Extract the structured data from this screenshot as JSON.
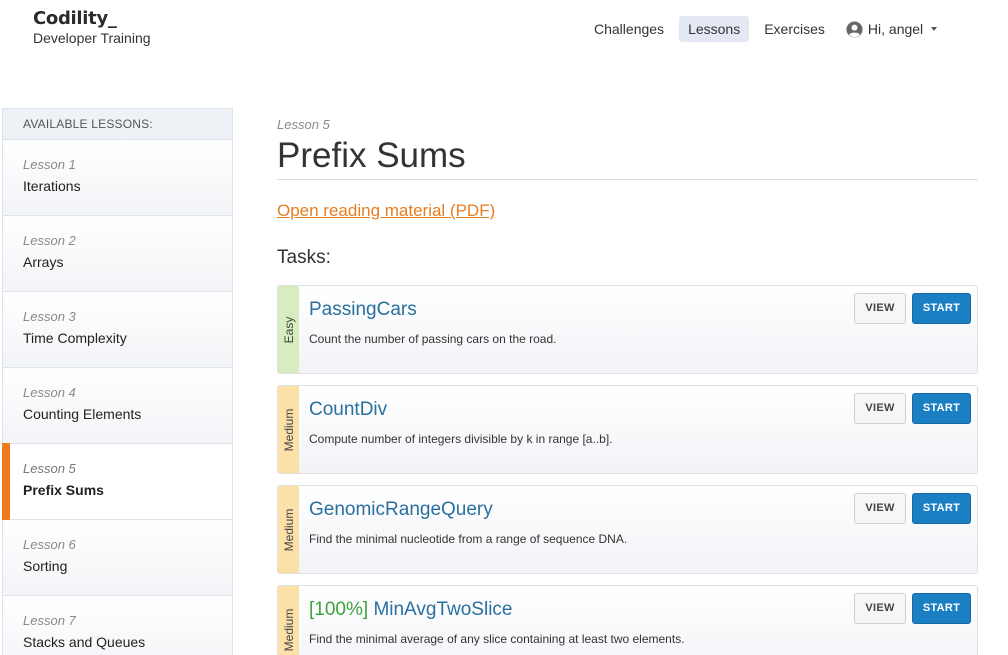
{
  "brand": {
    "logo": "Codility_",
    "subtitle": "Developer Training"
  },
  "nav": {
    "items": [
      {
        "label": "Challenges",
        "active": false
      },
      {
        "label": "Lessons",
        "active": true
      },
      {
        "label": "Exercises",
        "active": false
      }
    ],
    "user_label": "Hi, angel"
  },
  "sidebar": {
    "header": "AVAILABLE LESSONS:",
    "lessons": [
      {
        "number": "Lesson 1",
        "title": "Iterations"
      },
      {
        "number": "Lesson 2",
        "title": "Arrays"
      },
      {
        "number": "Lesson 3",
        "title": "Time Complexity"
      },
      {
        "number": "Lesson 4",
        "title": "Counting Elements"
      },
      {
        "number": "Lesson 5",
        "title": "Prefix Sums"
      },
      {
        "number": "Lesson 6",
        "title": "Sorting"
      },
      {
        "number": "Lesson 7",
        "title": "Stacks and Queues"
      }
    ],
    "active_index": 4
  },
  "main": {
    "lesson_label": "Lesson 5",
    "title": "Prefix Sums",
    "pdf_link": "Open reading material (PDF)",
    "tasks_heading": "Tasks:",
    "tasks": [
      {
        "difficulty": "Easy",
        "score": "",
        "name": "PassingCars",
        "description": "Count the number of passing cars on the road.",
        "view_label": "VIEW",
        "start_label": "START"
      },
      {
        "difficulty": "Medium",
        "score": "",
        "name": "CountDiv",
        "description": "Compute number of integers divisible by k in range [a..b].",
        "view_label": "VIEW",
        "start_label": "START"
      },
      {
        "difficulty": "Medium",
        "score": "",
        "name": "GenomicRangeQuery",
        "description": "Find the minimal nucleotide from a range of sequence DNA.",
        "view_label": "VIEW",
        "start_label": "START"
      },
      {
        "difficulty": "Medium",
        "score": "[100%]",
        "name": "MinAvgTwoSlice",
        "description": "Find the minimal average of any slice containing at least two elements.",
        "view_label": "VIEW",
        "start_label": "START"
      }
    ]
  },
  "colors": {
    "accent": "#f07a1a",
    "link": "#e67e22",
    "task_title": "#2a6f9e",
    "start_button": "#1b7fc4",
    "score": "#3fa23f",
    "easy": "#d7edbf",
    "medium": "#fbe1a8"
  }
}
